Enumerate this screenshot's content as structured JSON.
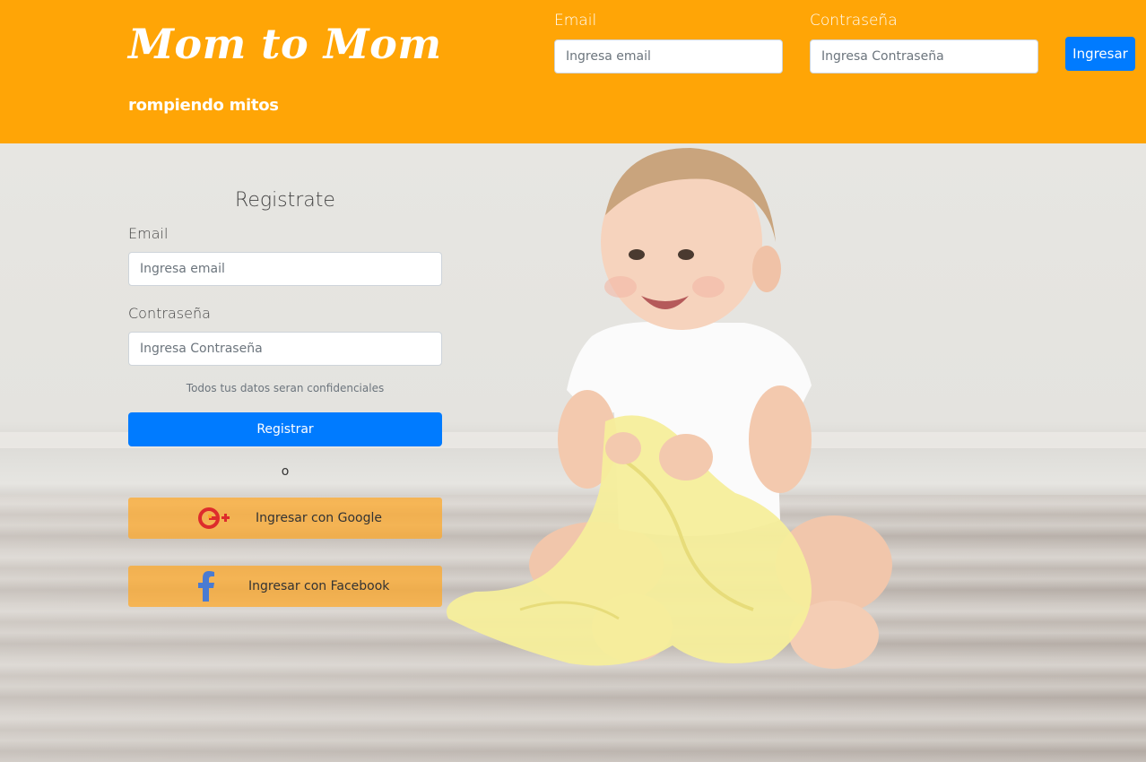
{
  "header": {
    "logo": "Mom to Mom",
    "tagline": "rompiendo mitos",
    "email_label": "Email",
    "email_placeholder": "Ingresa email",
    "password_label": "Contraseña",
    "password_placeholder": "Ingresa Contraseña",
    "login_button": "Ingresar"
  },
  "register": {
    "title": "Registrate",
    "email_label": "Email",
    "email_placeholder": "Ingresa email",
    "password_label": "Contraseña",
    "password_placeholder": "Ingresa Contraseña",
    "privacy_note": "Todos tus datos seran confidenciales",
    "submit_button": "Registrar",
    "separator": "o",
    "google_button": "Ingresar con Google",
    "facebook_button": "Ingresar con Facebook"
  },
  "icons": {
    "google": "google-plus-icon",
    "facebook": "facebook-icon"
  },
  "colors": {
    "header_bg": "#ffa506",
    "primary": "#007bff",
    "social_bg": "#ffa726",
    "google_red": "#dd2c2c",
    "facebook_blue": "#4a7bd1"
  }
}
